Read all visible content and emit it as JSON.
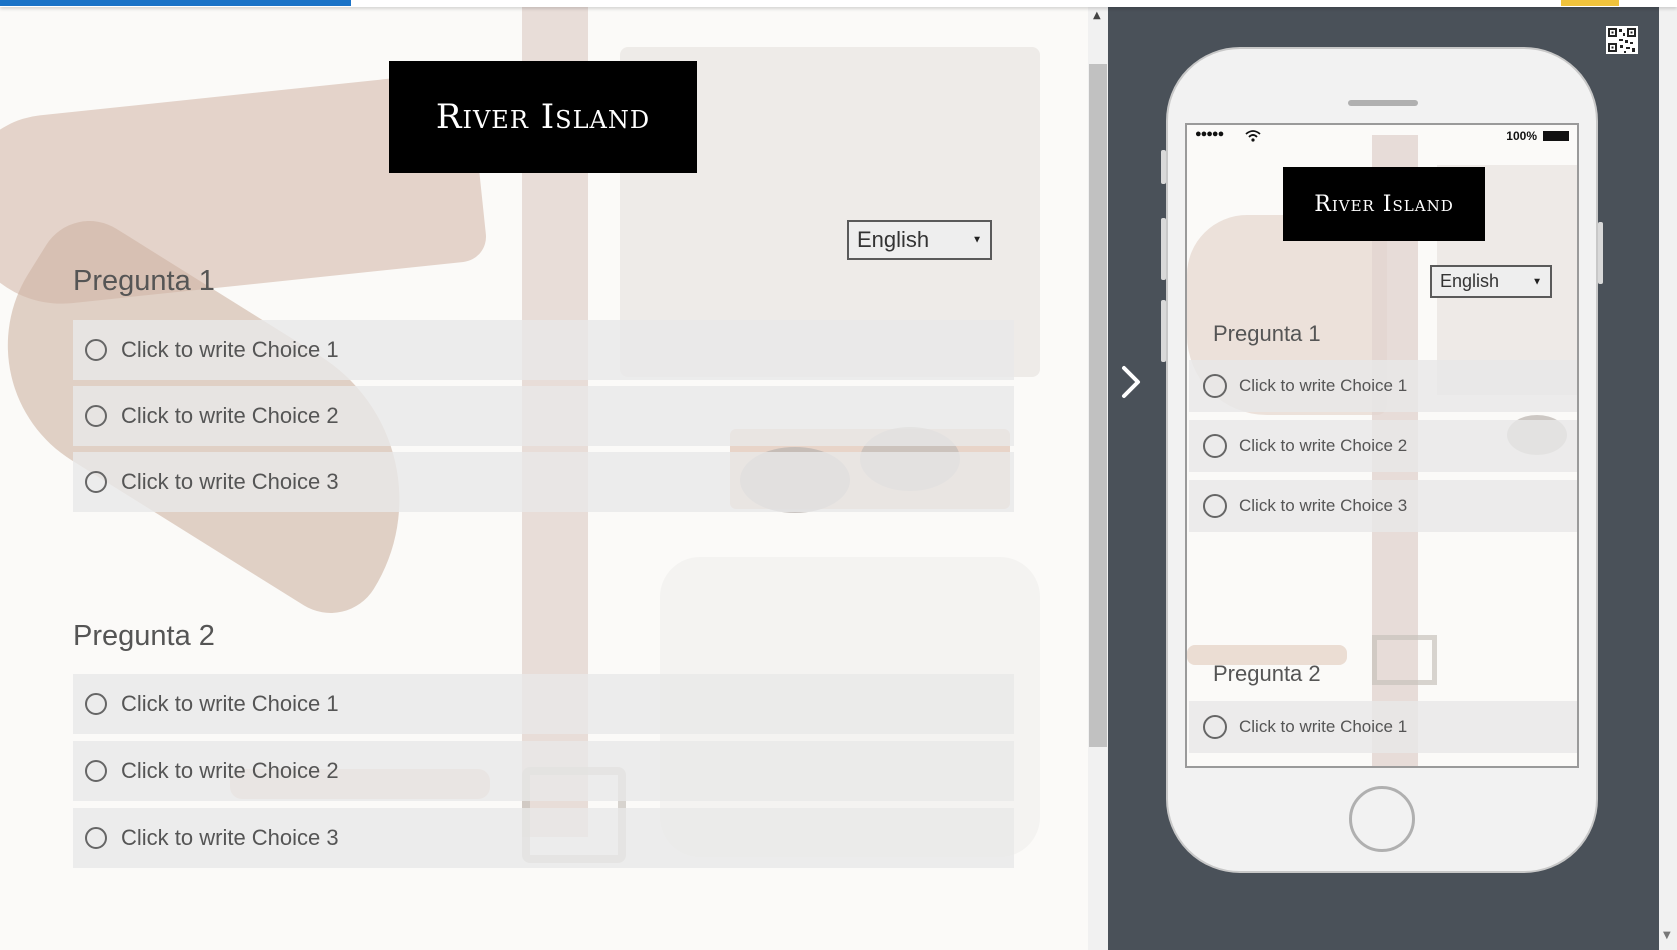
{
  "brand": {
    "name": "River Island"
  },
  "survey": {
    "language": "English",
    "questions": [
      {
        "title": "Pregunta 1",
        "choices": [
          "Click to write Choice 1",
          "Click to write Choice 2",
          "Click to write Choice 3"
        ]
      },
      {
        "title": "Pregunta 2",
        "choices": [
          "Click to write Choice 1",
          "Click to write Choice 2",
          "Click to write Choice 3"
        ]
      }
    ]
  },
  "preview": {
    "status_bar": {
      "signal": "●●●●●",
      "battery": "100%"
    },
    "language": "English",
    "questions": [
      {
        "title": "Pregunta 1",
        "choices": [
          "Click to write Choice 1",
          "Click to write Choice 2",
          "Click to write Choice 3"
        ]
      },
      {
        "title": "Pregunta 2",
        "choices": [
          "Click to write Choice 1"
        ]
      }
    ]
  },
  "icons": {
    "qr": "qr-code-icon",
    "toggle": "chevron-right-icon",
    "dropdown": "caret-down-icon",
    "wifi": "wifi-icon",
    "battery": "battery-icon"
  },
  "colors": {
    "progress": "#1a73c7",
    "accent": "#f0c33c",
    "preview_panel": "#4a5159",
    "logo_bg": "#000000"
  }
}
